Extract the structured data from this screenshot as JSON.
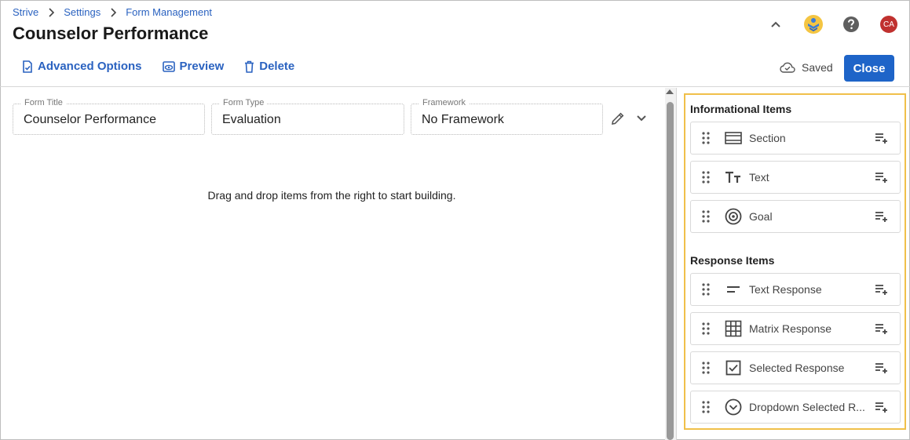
{
  "breadcrumb": [
    "Strive",
    "Settings",
    "Form Management"
  ],
  "page_title": "Counselor Performance",
  "header": {
    "avatar_initials": "CA"
  },
  "toolbar": {
    "advanced_options": "Advanced Options",
    "preview": "Preview",
    "delete": "Delete",
    "saved": "Saved",
    "close": "Close"
  },
  "form": {
    "title_label": "Form Title",
    "title_value": "Counselor Performance",
    "type_label": "Form Type",
    "type_value": "Evaluation",
    "framework_label": "Framework",
    "framework_value": "No Framework"
  },
  "empty_message": "Drag and drop items from the right to start building.",
  "palette": {
    "informational_heading": "Informational Items",
    "informational_items": [
      {
        "label": "Section",
        "icon": "section-icon"
      },
      {
        "label": "Text",
        "icon": "text-format-icon"
      },
      {
        "label": "Goal",
        "icon": "goal-target-icon"
      }
    ],
    "response_heading": "Response Items",
    "response_items": [
      {
        "label": "Text Response",
        "icon": "short-text-icon"
      },
      {
        "label": "Matrix Response",
        "icon": "grid-icon"
      },
      {
        "label": "Selected Response",
        "icon": "checkbox-icon"
      },
      {
        "label": "Dropdown Selected R...",
        "icon": "dropdown-circle-icon"
      }
    ]
  },
  "colors": {
    "accent": "#1e64c8",
    "link": "#2a62c0",
    "highlight_border": "#f0c04a",
    "avatar": "#c0312f"
  }
}
